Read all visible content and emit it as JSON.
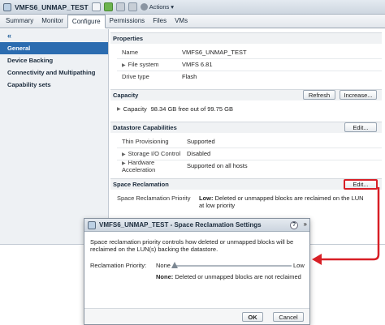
{
  "window": {
    "title": "VMFS6_UNMAP_TEST",
    "actions_label": "Actions",
    "actions_caret": "▾"
  },
  "tabs": [
    "Summary",
    "Monitor",
    "Configure",
    "Permissions",
    "Files",
    "VMs"
  ],
  "sidebar": {
    "collapse_glyph": "«",
    "items": [
      "General",
      "Device Backing",
      "Connectivity and Multipathing",
      "Capability sets"
    ]
  },
  "properties": {
    "heading": "Properties",
    "rows": [
      {
        "label": "Name",
        "value": "VMFS6_UNMAP_TEST"
      },
      {
        "label": "File system",
        "value": "VMFS 6.81"
      },
      {
        "label": "Drive type",
        "value": "Flash"
      }
    ]
  },
  "capacity": {
    "heading": "Capacity",
    "label": "Capacity",
    "value": "98.34 GB free out of 99.75 GB",
    "refresh_label": "Refresh",
    "increase_label": "Increase..."
  },
  "capabilities": {
    "heading": "Datastore Capabilities",
    "edit_label": "Edit...",
    "rows": [
      {
        "label": "Thin Provisioning",
        "value": "Supported"
      },
      {
        "label": "Storage I/O Control",
        "value": "Disabled"
      },
      {
        "label": "Hardware Acceleration",
        "value": "Supported on all hosts"
      }
    ]
  },
  "reclamation": {
    "heading": "Space Reclamation",
    "edit_label": "Edit...",
    "priority_label": "Space Reclamation Priority",
    "priority_bold": "Low:",
    "priority_text": " Deleted or unmapped blocks are reclaimed on the LUN at low priority"
  },
  "dialog": {
    "title": "VMFS6_UNMAP_TEST - Space Reclamation Settings",
    "help_glyph": "?",
    "expand_glyph": "»",
    "description": "Space reclamation priority controls how deleted or unmapped blocks will be reclaimed on the LUN(s) backing the datastore.",
    "priority_label": "Reclamation Priority:",
    "slider_min": "None",
    "slider_max": "Low",
    "slider_value": 0,
    "note_bold": "None:",
    "note_text": " Deleted or unmapped blocks are not reclaimed",
    "ok_label": "OK",
    "cancel_label": "Cancel"
  },
  "colors": {
    "highlight": "#d81f26",
    "selected": "#2b6cb0"
  }
}
